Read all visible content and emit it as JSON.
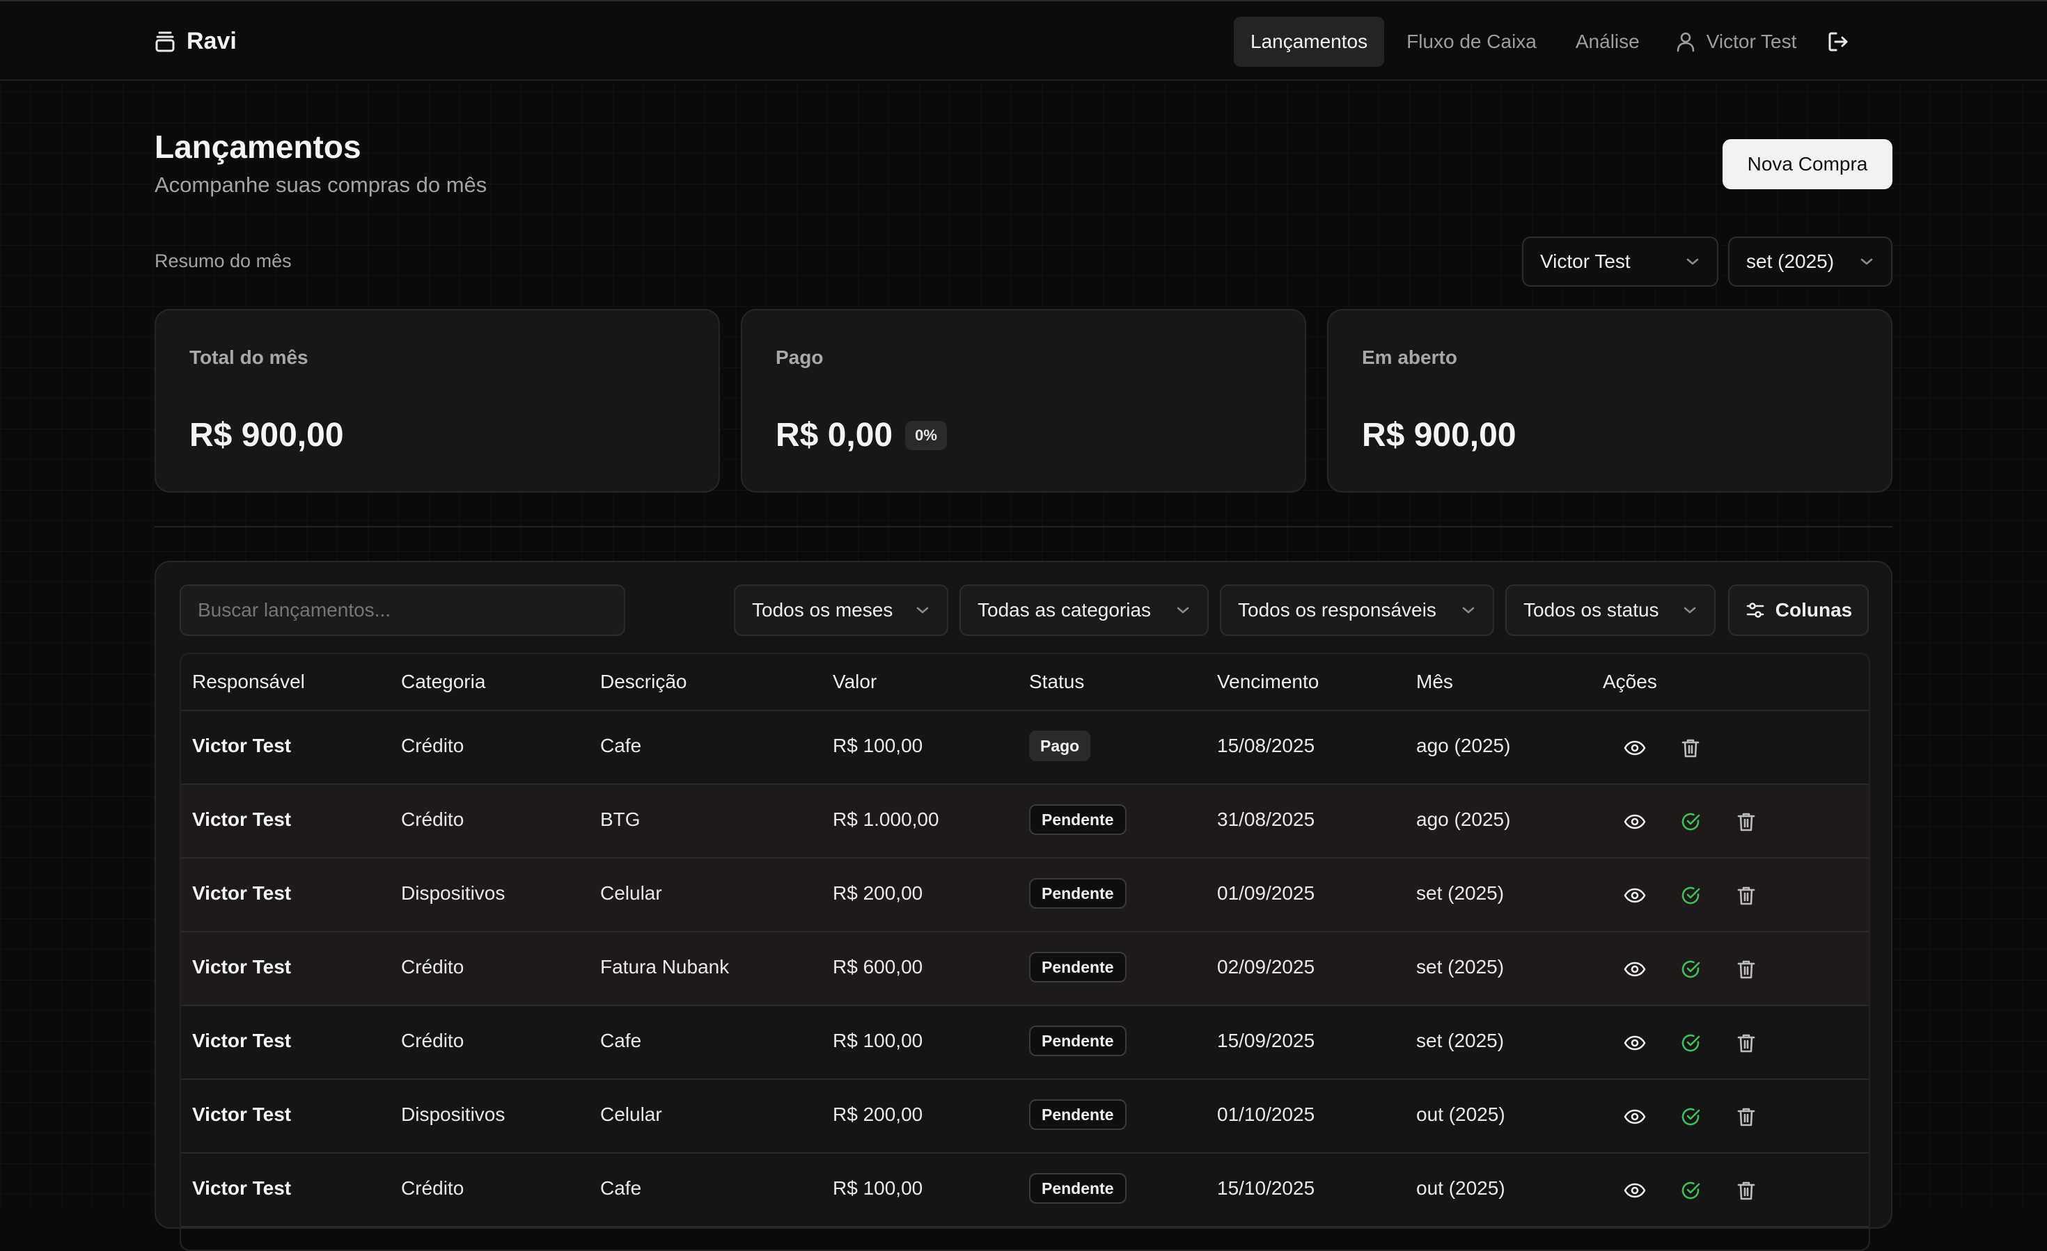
{
  "app": {
    "name": "Ravi"
  },
  "nav": {
    "items": [
      {
        "label": "Lançamentos",
        "active": true
      },
      {
        "label": "Fluxo de Caixa",
        "active": false
      },
      {
        "label": "Análise",
        "active": false
      }
    ],
    "user": "Victor Test"
  },
  "header": {
    "title": "Lançamentos",
    "subtitle": "Acompanhe suas compras do mês",
    "new_button": "Nova Compra"
  },
  "summary": {
    "label": "Resumo do mês",
    "user_select": "Victor Test",
    "month_select": "set (2025)",
    "cards": [
      {
        "label": "Total do mês",
        "value": "R$ 900,00"
      },
      {
        "label": "Pago",
        "value": "R$ 0,00",
        "badge": "0%"
      },
      {
        "label": "Em aberto",
        "value": "R$ 900,00"
      }
    ]
  },
  "filters": {
    "search_placeholder": "Buscar lançamentos...",
    "months": "Todos os meses",
    "categories": "Todas as categorias",
    "owners": "Todos os responsáveis",
    "status": "Todos os status",
    "columns": "Colunas"
  },
  "table": {
    "headers": [
      "Responsável",
      "Categoria",
      "Descrição",
      "Valor",
      "Status",
      "Vencimento",
      "Mês",
      "Ações"
    ],
    "rows": [
      {
        "owner": "Victor Test",
        "category": "Crédito",
        "description": "Cafe",
        "value": "R$ 100,00",
        "status": "Pago",
        "due": "15/08/2025",
        "month": "ago (2025)"
      },
      {
        "owner": "Victor Test",
        "category": "Crédito",
        "description": "BTG",
        "value": "R$ 1.000,00",
        "status": "Pendente",
        "due": "31/08/2025",
        "month": "ago (2025)"
      },
      {
        "owner": "Victor Test",
        "category": "Dispositivos",
        "description": "Celular",
        "value": "R$ 200,00",
        "status": "Pendente",
        "due": "01/09/2025",
        "month": "set (2025)"
      },
      {
        "owner": "Victor Test",
        "category": "Crédito",
        "description": "Fatura Nubank",
        "value": "R$ 600,00",
        "status": "Pendente",
        "due": "02/09/2025",
        "month": "set (2025)"
      },
      {
        "owner": "Victor Test",
        "category": "Crédito",
        "description": "Cafe",
        "value": "R$ 100,00",
        "status": "Pendente",
        "due": "15/09/2025",
        "month": "set (2025)"
      },
      {
        "owner": "Victor Test",
        "category": "Dispositivos",
        "description": "Celular",
        "value": "R$ 200,00",
        "status": "Pendente",
        "due": "01/10/2025",
        "month": "out (2025)"
      },
      {
        "owner": "Victor Test",
        "category": "Crédito",
        "description": "Cafe",
        "value": "R$ 100,00",
        "status": "Pendente",
        "due": "15/10/2025",
        "month": "out (2025)"
      }
    ]
  },
  "colors": {
    "background": "#0b0b0b",
    "card": "#171717",
    "accent_green": "#3fbf5a",
    "highlight_row": "#1e1a19"
  },
  "icons": [
    "wallet-icon",
    "user-icon",
    "logout-icon",
    "chevron-down-icon",
    "sliders-icon",
    "eye-icon",
    "check-circle-icon",
    "trash-icon"
  ]
}
